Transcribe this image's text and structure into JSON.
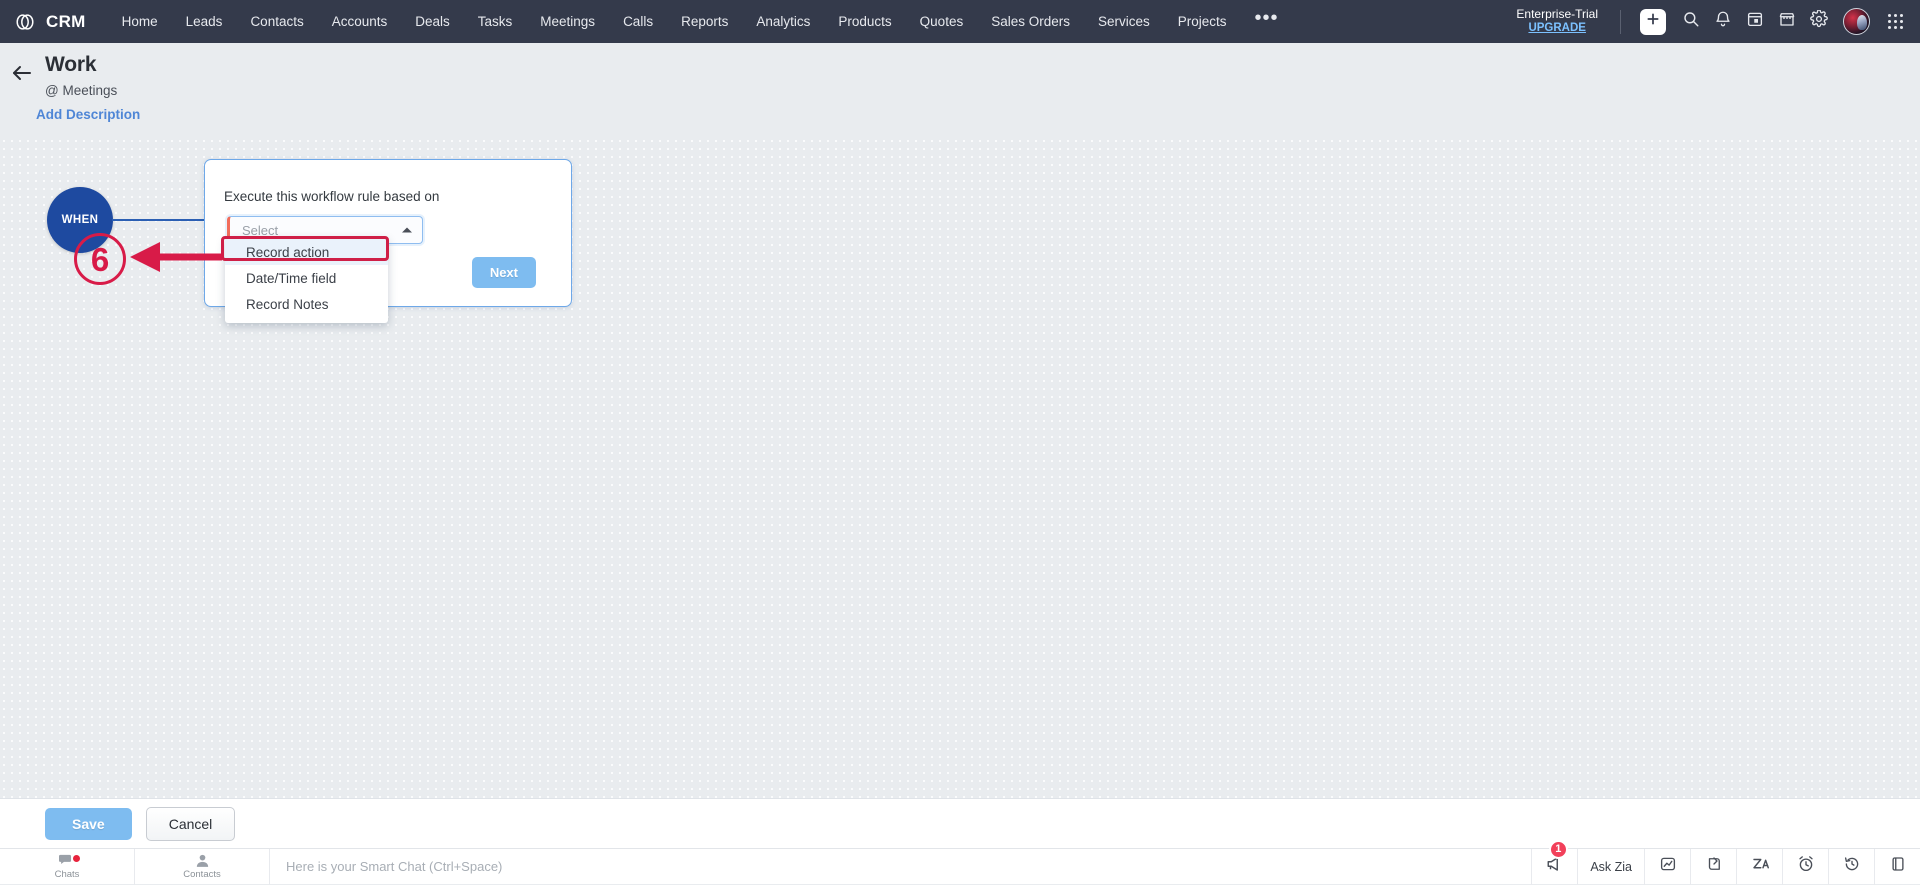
{
  "topnav": {
    "brand": "CRM",
    "brand_icon": "crm-logo-icon",
    "items": [
      {
        "label": "Home"
      },
      {
        "label": "Leads"
      },
      {
        "label": "Contacts"
      },
      {
        "label": "Accounts"
      },
      {
        "label": "Deals"
      },
      {
        "label": "Tasks"
      },
      {
        "label": "Meetings"
      },
      {
        "label": "Calls"
      },
      {
        "label": "Reports"
      },
      {
        "label": "Analytics"
      },
      {
        "label": "Products"
      },
      {
        "label": "Quotes"
      },
      {
        "label": "Sales Orders"
      },
      {
        "label": "Services"
      },
      {
        "label": "Projects"
      }
    ],
    "more_label": "•••",
    "trial_name": "Enterprise-Trial",
    "trial_upgrade": "UPGRADE",
    "icons": [
      "plus-icon",
      "search-icon",
      "bell-icon",
      "calendar-icon",
      "store-icon",
      "gear-icon",
      "avatar",
      "apps-grid-icon"
    ]
  },
  "header": {
    "back_icon": "back-arrow-icon",
    "title": "Work",
    "module": "@ Meetings",
    "add_description": "Add Description"
  },
  "canvas": {
    "when_node_label": "WHEN",
    "card": {
      "prompt": "Execute this workflow rule based on",
      "select_placeholder": "Select",
      "select_value": "",
      "next_label": "Next"
    },
    "dropdown": {
      "options": [
        {
          "label": "Record action",
          "selected": true
        },
        {
          "label": "Date/Time field",
          "selected": false
        },
        {
          "label": "Record Notes",
          "selected": false
        }
      ]
    },
    "annotation": {
      "step_number": "6",
      "color": "#d81b48"
    }
  },
  "actionbar": {
    "save_label": "Save",
    "cancel_label": "Cancel"
  },
  "statusbar": {
    "left_items": [
      {
        "label": "Chats",
        "icon": "chats-icon",
        "badge": true
      },
      {
        "label": "Contacts",
        "icon": "contacts-icon",
        "badge": false
      }
    ],
    "smart_chat_placeholder": "Here is your Smart Chat (Ctrl+Space)",
    "right_items": [
      {
        "icon": "megaphone-icon",
        "label": "",
        "badge": "1"
      },
      {
        "icon": "ask-zia-text",
        "label": "Ask Zia",
        "badge": ""
      },
      {
        "icon": "analytics-card-icon",
        "label": "",
        "badge": ""
      },
      {
        "icon": "popout-icon",
        "label": "",
        "badge": ""
      },
      {
        "icon": "zia-icon",
        "label": "",
        "badge": ""
      },
      {
        "icon": "alarm-clock-icon",
        "label": "",
        "badge": ""
      },
      {
        "icon": "history-icon",
        "label": "",
        "badge": ""
      },
      {
        "icon": "panel-icon",
        "label": "",
        "badge": ""
      }
    ]
  },
  "colors": {
    "nav_bg": "#343a4b",
    "canvas_bg": "#e9ecef",
    "when_node": "#1e4aa0",
    "accent_blue": "#7ebcf0",
    "annotation_red": "#d81b48",
    "required_marker": "#f26d5b"
  }
}
